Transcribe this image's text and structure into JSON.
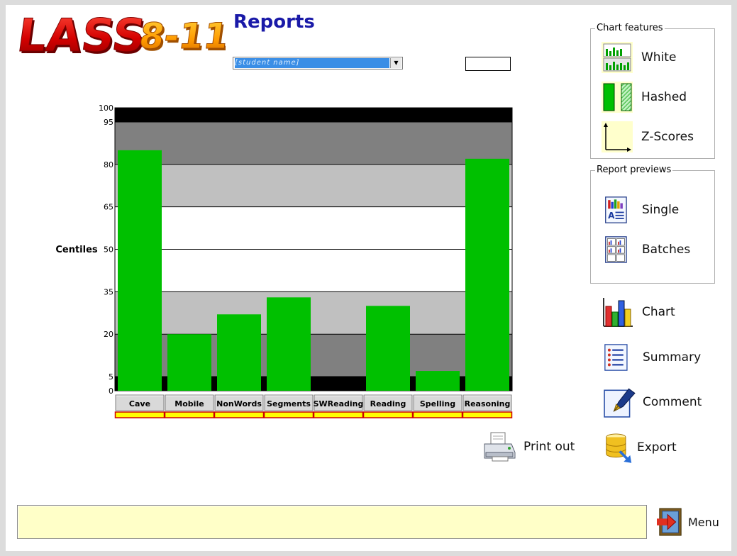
{
  "app": {
    "logo_text": "LASS8-11",
    "page_title": "Reports"
  },
  "pupil_select": {
    "value": "[student name]"
  },
  "chart_data": {
    "type": "bar",
    "categories": [
      "Cave",
      "Mobile",
      "NonWords",
      "Segments",
      "SWReading",
      "Reading",
      "Spelling",
      "Reasoning"
    ],
    "values": [
      85,
      20,
      27,
      33,
      null,
      30,
      7,
      82
    ],
    "ylabel": "Centiles",
    "ylim": [
      0,
      100
    ],
    "yticks": [
      0,
      5,
      20,
      35,
      50,
      65,
      80,
      95,
      100
    ],
    "bands": [
      {
        "from": 0,
        "to": 5,
        "color": "#000000"
      },
      {
        "from": 5,
        "to": 20,
        "color": "#808080"
      },
      {
        "from": 20,
        "to": 35,
        "color": "#c0c0c0"
      },
      {
        "from": 35,
        "to": 65,
        "color": "#ffffff"
      },
      {
        "from": 65,
        "to": 80,
        "color": "#c0c0c0"
      },
      {
        "from": 80,
        "to": 95,
        "color": "#808080"
      },
      {
        "from": 95,
        "to": 100,
        "color": "#000000"
      }
    ],
    "bar_color": "#00c000",
    "indicator_fill": "#ffff00",
    "indicator_border": "#cc0000"
  },
  "chart_features": {
    "legend": "Chart features",
    "items": [
      {
        "label": "White",
        "icon": "white-chart-icon"
      },
      {
        "label": "Hashed",
        "icon": "hashed-chart-icon"
      },
      {
        "label": "Z-Scores",
        "icon": "z-scores-icon"
      }
    ]
  },
  "report_previews": {
    "legend": "Report previews",
    "items": [
      {
        "label": "Single",
        "icon": "single-report-icon"
      },
      {
        "label": "Batches",
        "icon": "batch-report-icon"
      }
    ]
  },
  "actions": {
    "chart": "Chart",
    "summary": "Summary",
    "comment": "Comment",
    "print": "Print out",
    "export": "Export",
    "menu": "Menu"
  },
  "status": {
    "text": ""
  }
}
